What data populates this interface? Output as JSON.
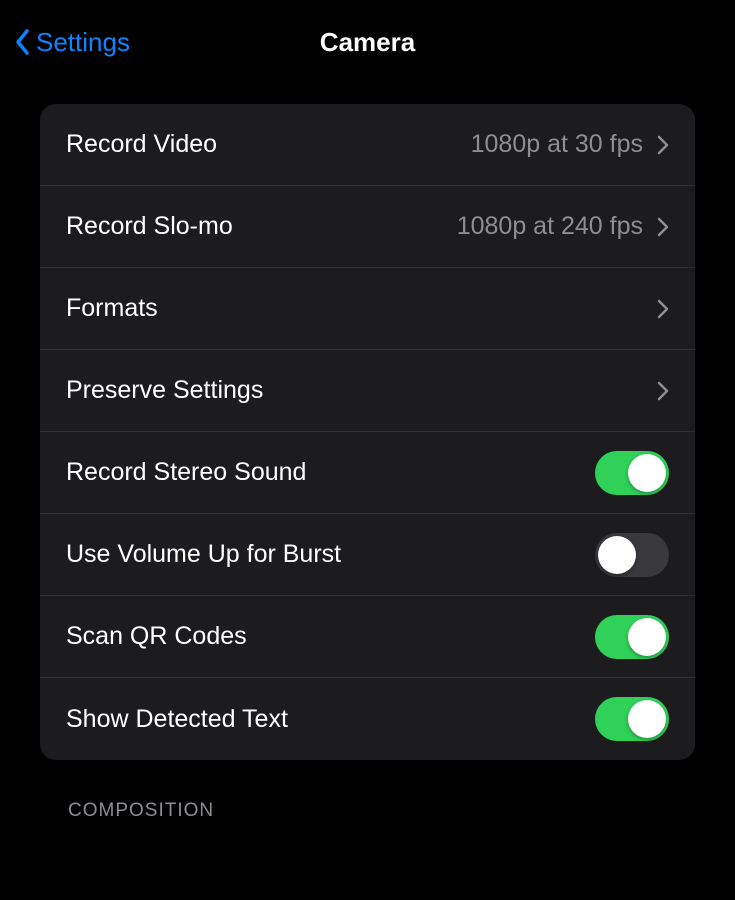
{
  "navbar": {
    "back_label": "Settings",
    "title": "Camera"
  },
  "rows": {
    "record_video": {
      "label": "Record Video",
      "value": "1080p at 30 fps"
    },
    "record_slomo": {
      "label": "Record Slo-mo",
      "value": "1080p at 240 fps"
    },
    "formats": {
      "label": "Formats"
    },
    "preserve_settings": {
      "label": "Preserve Settings"
    },
    "record_stereo": {
      "label": "Record Stereo Sound",
      "enabled": true
    },
    "volume_burst": {
      "label": "Use Volume Up for Burst",
      "enabled": false
    },
    "scan_qr": {
      "label": "Scan QR Codes",
      "enabled": true
    },
    "detected_text": {
      "label": "Show Detected Text",
      "enabled": true
    }
  },
  "section_header": "COMPOSITION",
  "colors": {
    "accent_blue": "#0a84ff",
    "toggle_on": "#30d158",
    "toggle_off": "#39393d",
    "background": "#000000",
    "cell_background": "#1c1c1e",
    "separator": "#313133",
    "secondary_text": "#8d8d93"
  }
}
